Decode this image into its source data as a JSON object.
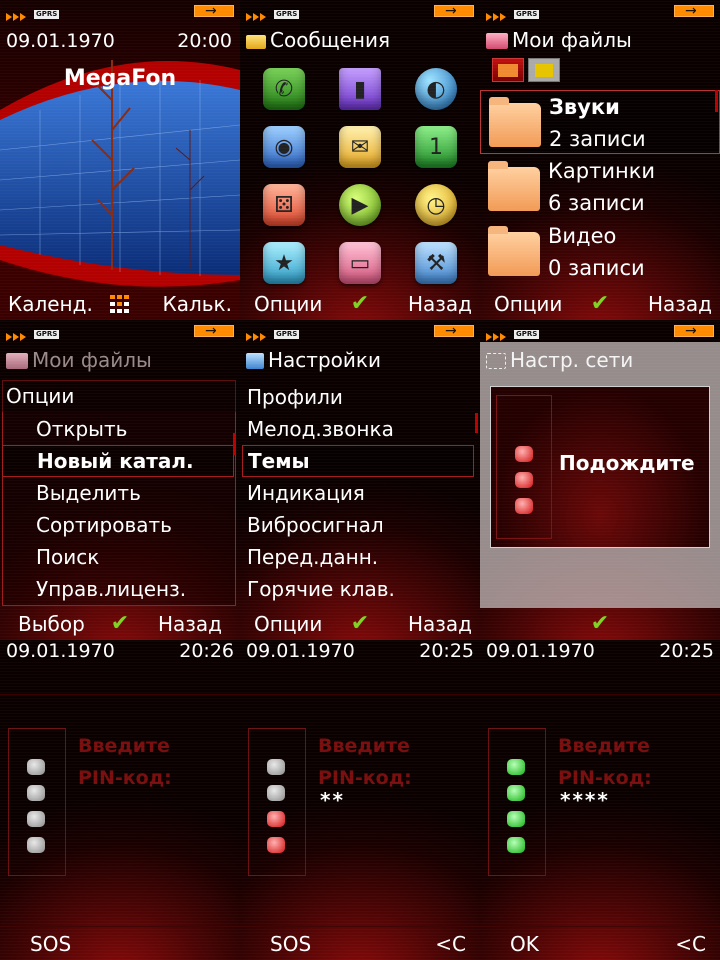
{
  "colors": {
    "accent": "#ff8a00",
    "check": "#7fd321",
    "highlight_border": "#a61d1d"
  },
  "status": {
    "gprs": "GPRS"
  },
  "home": {
    "date": "09.01.1970",
    "time": "20:00",
    "operator": "MegaFon",
    "soft_left": "Календ.",
    "soft_center_icon": "grid-dots-icon",
    "soft_right": "Кальк."
  },
  "messages": {
    "title": "Сообщения",
    "icons": [
      "phone-icon",
      "contacts-icon",
      "globe-icon",
      "camera-icon",
      "envelope-icon",
      "calendar-icon",
      "dice-icon",
      "play-icon",
      "clock-icon",
      "star-box-icon",
      "folder-icon",
      "wrench-icon"
    ],
    "soft_left": "Опции",
    "soft_right": "Назад"
  },
  "files": {
    "title": "Мои файлы",
    "items": [
      {
        "name": "Звуки",
        "count": "2 записи"
      },
      {
        "name": "Картинки",
        "count": "6 записи"
      },
      {
        "name": "Видео",
        "count": "0 записи"
      }
    ],
    "soft_left": "Опции",
    "soft_right": "Назад"
  },
  "options": {
    "title": "Мои файлы",
    "header": "Опции",
    "items": [
      "Открыть",
      "Новый катал.",
      "Выделить",
      "Сортировать",
      "Поиск",
      "Управ.лиценз."
    ],
    "selected_index": 1,
    "soft_left": "Выбор",
    "soft_right": "Назад"
  },
  "settings": {
    "title": "Настройки",
    "items": [
      "Профили",
      "Мелод.звонка",
      "Темы",
      "Индикация",
      "Вибросигнал",
      "Перед.данн.",
      "Горячие клав."
    ],
    "selected_index": 2,
    "soft_left": "Опции",
    "soft_right": "Назад"
  },
  "network": {
    "title": "Настр. сети",
    "wait_text": "Подождите"
  },
  "pin1": {
    "date": "09.01.1970",
    "time": "20:26",
    "label_line1": "Введите",
    "label_line2": "PIN-код:",
    "value": "",
    "leds": [
      "off",
      "off",
      "off",
      "off"
    ],
    "soft_left": "SOS",
    "soft_right": ""
  },
  "pin2": {
    "date": "09.01.1970",
    "time": "20:25",
    "label_line1": "Введите",
    "label_line2": "PIN-код:",
    "value": "**",
    "leds": [
      "off",
      "off",
      "red",
      "red"
    ],
    "soft_left": "SOS",
    "soft_right": "<C"
  },
  "pin3": {
    "date": "09.01.1970",
    "time": "20:25",
    "label_line1": "Введите",
    "label_line2": "PIN-код:",
    "value": "****",
    "leds": [
      "green",
      "green",
      "green",
      "green"
    ],
    "soft_left": "OK",
    "soft_right": "<C"
  }
}
